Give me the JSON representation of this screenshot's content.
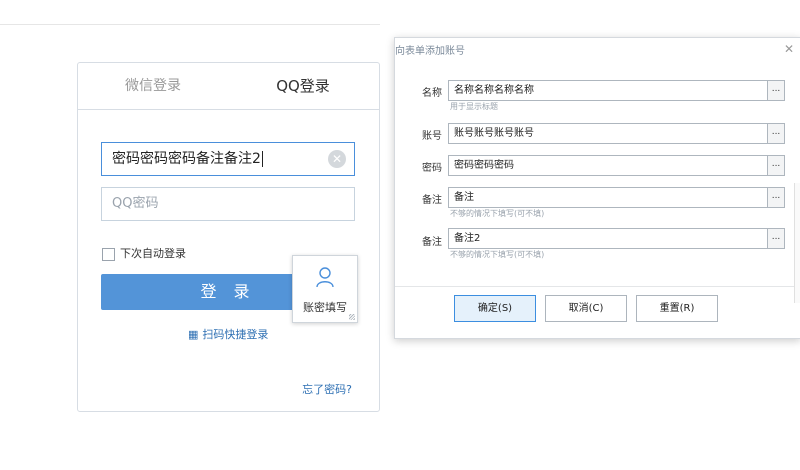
{
  "login": {
    "tab_wechat": "微信登录",
    "tab_qq": "QQ登录",
    "account_value": "密码密码密码备注备注2",
    "password_placeholder": "QQ密码",
    "remember_label": "下次自动登录",
    "login_button": "登 录",
    "scan_label": "扫码快捷登录",
    "forgot_label": "忘了密码?",
    "autofill_label": "账密填写"
  },
  "dialog": {
    "title": "向表单添加账号",
    "rows": [
      {
        "label": "名称",
        "value": "名称名称名称名称",
        "hint": "用于显示标题"
      },
      {
        "label": "账号",
        "value": "账号账号账号账号",
        "hint": ""
      },
      {
        "label": "密码",
        "value": "密码密码密码",
        "hint": ""
      },
      {
        "label": "备注",
        "value": "备注",
        "hint": "不够的情况下填写(可不填)"
      },
      {
        "label": "备注",
        "value": "备注2",
        "hint": "不够的情况下填写(可不填)"
      }
    ],
    "more_label": "...",
    "confirm": "确定(S)",
    "cancel": "取消(C)",
    "reset": "重置(R)"
  },
  "colors": {
    "accent": "#5394d8",
    "link": "#2d6fb3",
    "focus": "#4a8fdb"
  }
}
